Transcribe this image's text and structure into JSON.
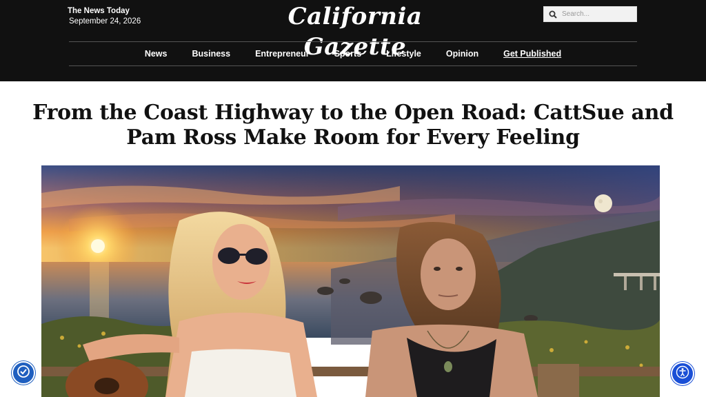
{
  "header": {
    "tagline": "The News Today",
    "date": "September 24, 2026",
    "logo": "California Gazette",
    "search": {
      "placeholder": "Search..."
    }
  },
  "nav": {
    "items": [
      "News",
      "Business",
      "Entrepreneur",
      "Sports",
      "Lifestyle",
      "Opinion",
      "Get Published"
    ]
  },
  "article": {
    "headline": "From the Coast Highway to the Open Road: CattSue and Pam Ross Make Room for Every Feeling",
    "hero_icon": "photo-two-women-coast-sunset"
  },
  "widgets": {
    "left_icon": "accessibility-widget-icon",
    "right_icon": "accessibility-person-icon"
  },
  "colors": {
    "header_bg": "#111111",
    "accent_blue": "#1a4fd6"
  }
}
